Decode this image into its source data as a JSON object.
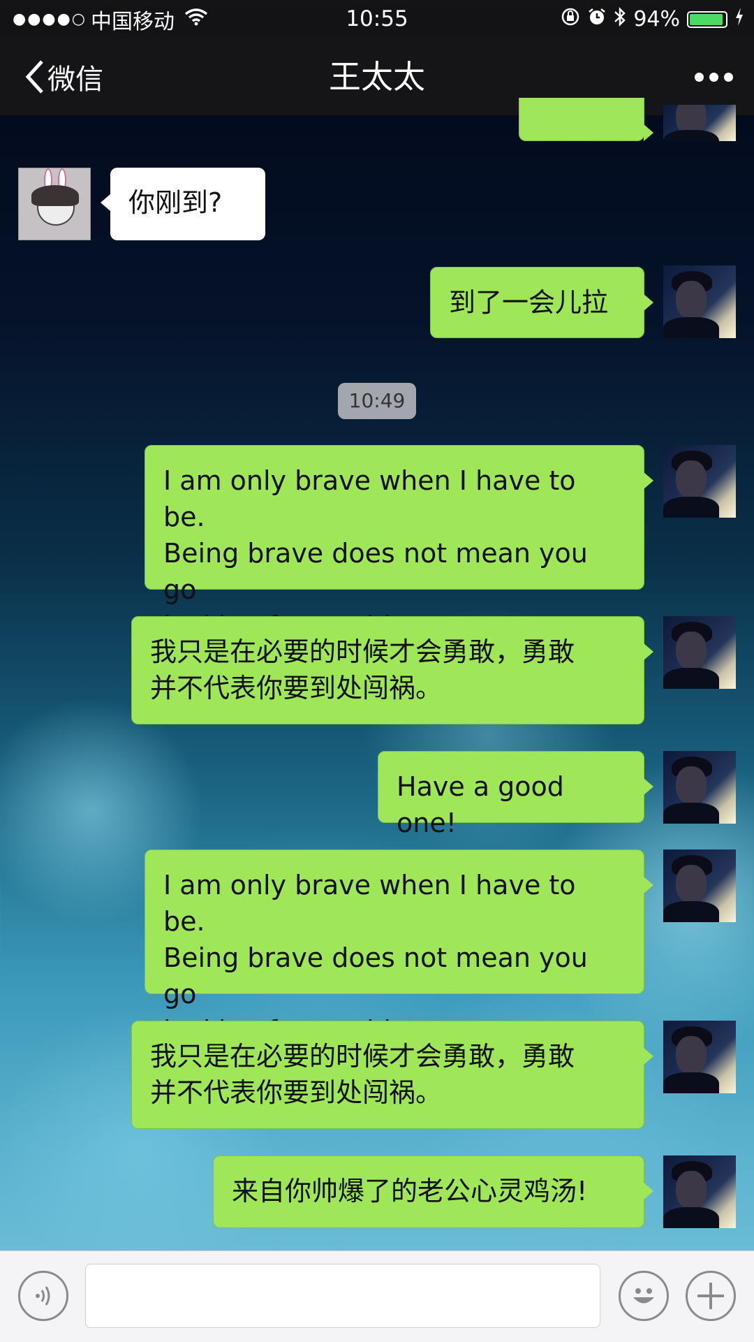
{
  "status_bar": {
    "signal_dots": "●●●●○",
    "carrier": "中国移动",
    "time": "10:55",
    "battery_percent": "94%",
    "battery_level": 0.94,
    "icons": [
      "wifi-icon",
      "rotation-lock-icon",
      "alarm-icon",
      "bluetooth-icon",
      "battery-icon",
      "charging-icon"
    ]
  },
  "nav": {
    "back_label": "微信",
    "title": "王太太",
    "more_icon": "more-icon"
  },
  "chat": {
    "partial_top": "",
    "her_message": "你刚到?",
    "timestamp": "10:49",
    "messages": [
      "到了一会儿拉",
      "I am only brave when I have to be.\nBeing brave does not mean you go\nlooking for trouble.",
      "我只是在必要的时候才会勇敢，勇敢\n并不代表你要到处闯祸。",
      "Have a good one!",
      "I am only brave when I have to be.\nBeing brave does not mean you go\nlooking for trouble.",
      "我只是在必要的时候才会勇敢，勇敢\n并不代表你要到处闯祸。",
      "来自你帅爆了的老公心灵鸡汤!"
    ]
  },
  "input_bar": {
    "value": "",
    "icons": [
      "voice-icon",
      "emoji-icon",
      "plus-icon"
    ]
  }
}
